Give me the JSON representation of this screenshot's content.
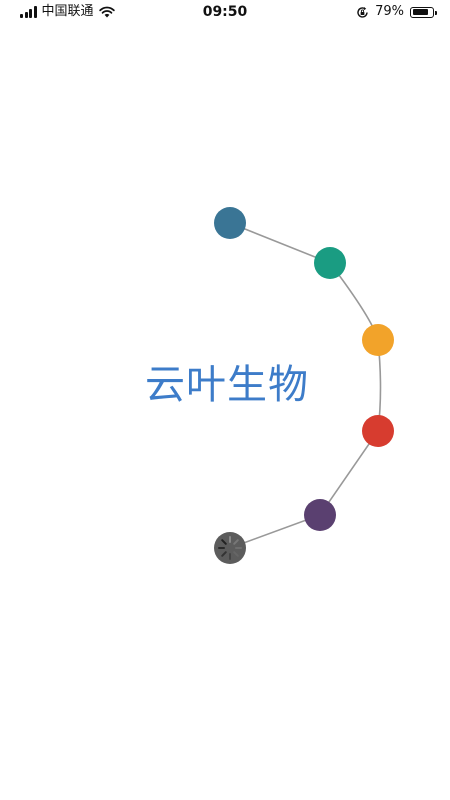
{
  "status_bar": {
    "carrier": "中国联通",
    "time": "09:50",
    "battery_percent": "79%",
    "battery_level": 0.79,
    "icons": [
      "signal-icon",
      "wifi-icon",
      "orientation-lock-icon",
      "battery-icon"
    ]
  },
  "splash": {
    "brand_name": "云叶生物",
    "brand_color": "#3d7cc9",
    "arc_color": "#999999",
    "dot_colors": [
      "#3a7595",
      "#1a9c82",
      "#f2a32a",
      "#d73c2f",
      "#5a4070",
      "#5c5c5c"
    ],
    "loading_indicator": "spinner-icon"
  }
}
